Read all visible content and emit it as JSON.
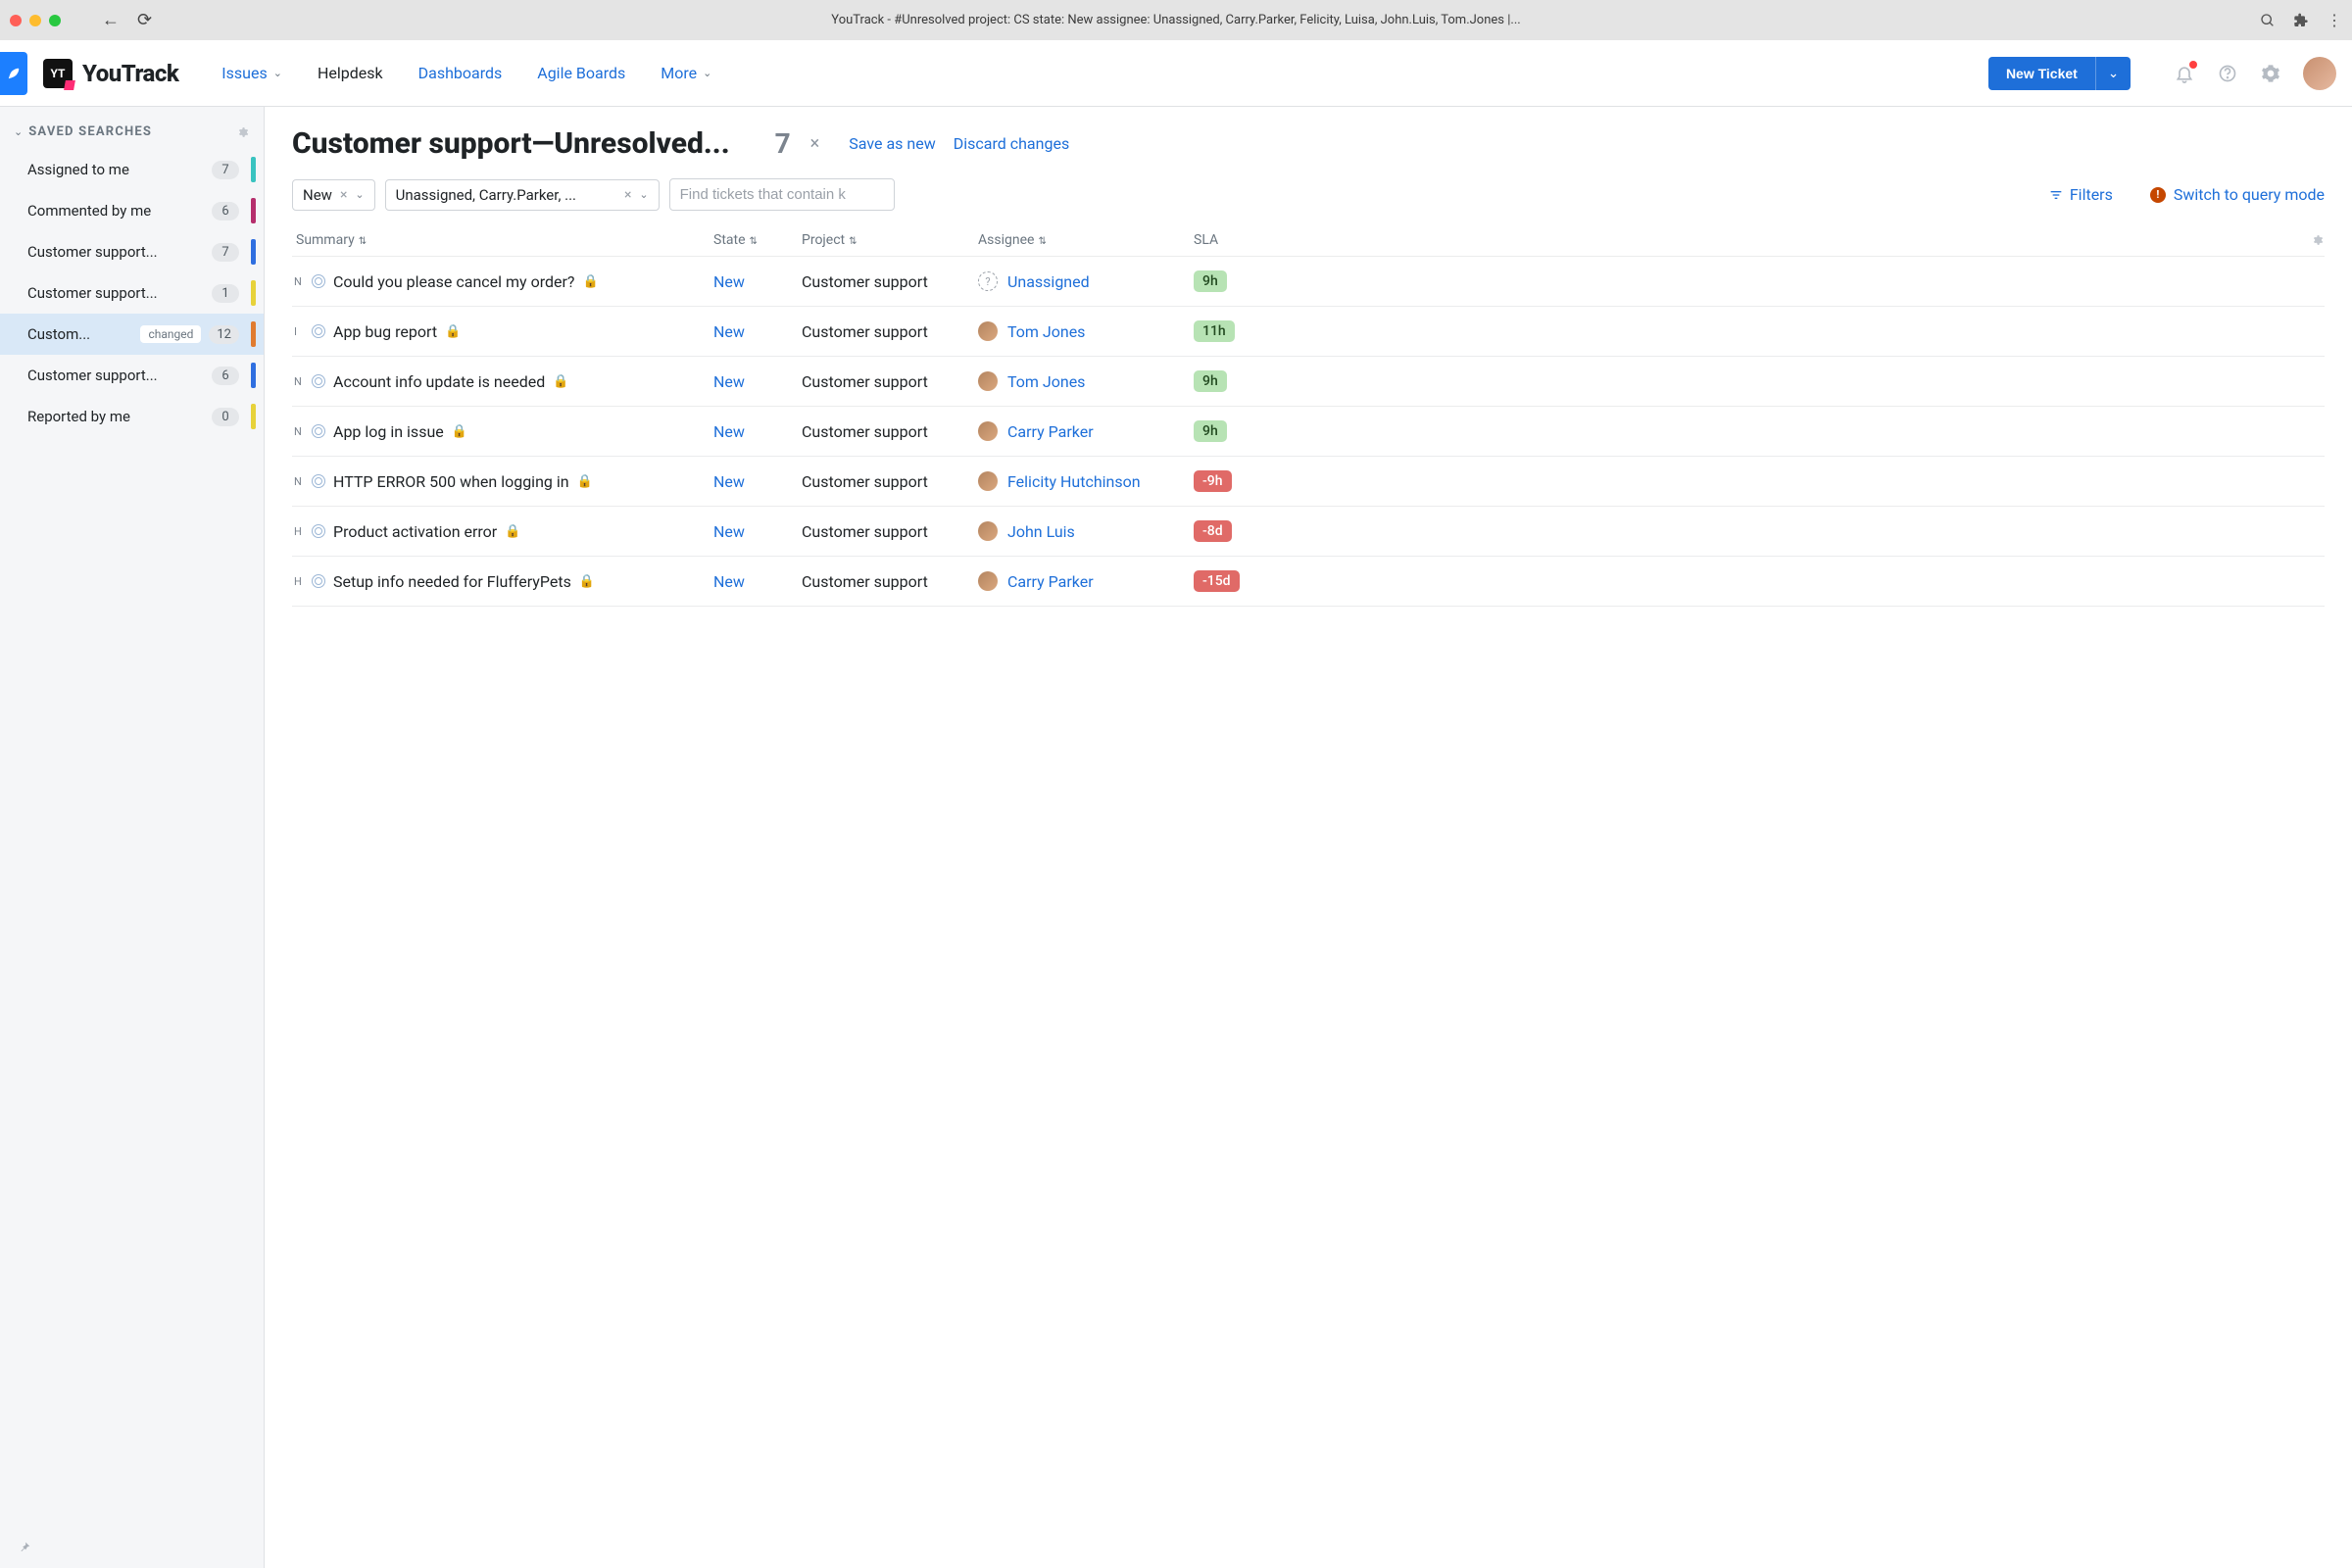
{
  "chrome": {
    "title": "YouTrack - #Unresolved project: CS state: New assignee: Unassigned, Carry.Parker, Felicity, Luisa, John.Luis, Tom.Jones |..."
  },
  "brand": {
    "logo_text": "YT",
    "name": "YouTrack"
  },
  "nav": {
    "issues": "Issues",
    "helpdesk": "Helpdesk",
    "dashboards": "Dashboards",
    "agile": "Agile Boards",
    "more": "More"
  },
  "header": {
    "new_ticket": "New Ticket"
  },
  "sidebar": {
    "title": "SAVED SEARCHES",
    "items": [
      {
        "label": "Assigned to me",
        "count": "7",
        "stripe": "#39c3c0"
      },
      {
        "label": "Commented by me",
        "count": "6",
        "stripe": "#b52e6c"
      },
      {
        "label": "Customer support...",
        "count": "7",
        "stripe": "#2f6fe0"
      },
      {
        "label": "Customer support...",
        "count": "1",
        "stripe": "#e7d23a"
      },
      {
        "label": "Custom...",
        "tag": "changed",
        "count": "12",
        "stripe": "#e07b2f",
        "selected": true
      },
      {
        "label": "Customer support...",
        "count": "6",
        "stripe": "#2f6fe0"
      },
      {
        "label": "Reported by me",
        "count": "0",
        "stripe": "#e7d23a"
      }
    ]
  },
  "page": {
    "title": "Customer support—Unresolved...",
    "count": "7",
    "save_as_new": "Save as new",
    "discard": "Discard changes"
  },
  "filters": {
    "chip1": "New",
    "chip2": "Unassigned, Carry.Parker, ...",
    "search_placeholder": "Find tickets that contain k",
    "filters_label": "Filters",
    "switch_label": "Switch to query mode"
  },
  "columns": {
    "summary": "Summary",
    "state": "State",
    "project": "Project",
    "assignee": "Assignee",
    "sla": "SLA"
  },
  "rows": [
    {
      "type": "N",
      "summary": "Could you please cancel my order?",
      "lock": true,
      "state": "New",
      "project": "Customer support",
      "assignee": "Unassigned",
      "ava": "unk",
      "sla": "9h",
      "sla_ok": true
    },
    {
      "type": "I",
      "summary": "App bug report",
      "lock": true,
      "state": "New",
      "project": "Customer support",
      "assignee": "Tom Jones",
      "ava": "a1",
      "sla": "11h",
      "sla_ok": true
    },
    {
      "type": "N",
      "summary": "Account info update is needed",
      "lock": true,
      "state": "New",
      "project": "Customer support",
      "assignee": "Tom Jones",
      "ava": "a1",
      "sla": "9h",
      "sla_ok": true
    },
    {
      "type": "N",
      "summary": "App log in issue",
      "lock": true,
      "state": "New",
      "project": "Customer support",
      "assignee": "Carry Parker",
      "ava": "a2",
      "sla": "9h",
      "sla_ok": true
    },
    {
      "type": "N",
      "summary": "HTTP ERROR 500 when logging in",
      "lock": true,
      "state": "New",
      "project": "Customer support",
      "assignee": "Felicity Hutchinson",
      "ava": "a3",
      "sla": "-9h",
      "sla_ok": false
    },
    {
      "type": "H",
      "summary": "Product activation error",
      "lock": true,
      "state": "New",
      "project": "Customer support",
      "assignee": "John Luis",
      "ava": "a4",
      "sla": "-8d",
      "sla_ok": false
    },
    {
      "type": "H",
      "summary": "Setup info needed for FlufferyPets",
      "lock": true,
      "state": "New",
      "project": "Customer support",
      "assignee": "Carry Parker",
      "ava": "a2",
      "sla": "-15d",
      "sla_ok": false
    }
  ]
}
